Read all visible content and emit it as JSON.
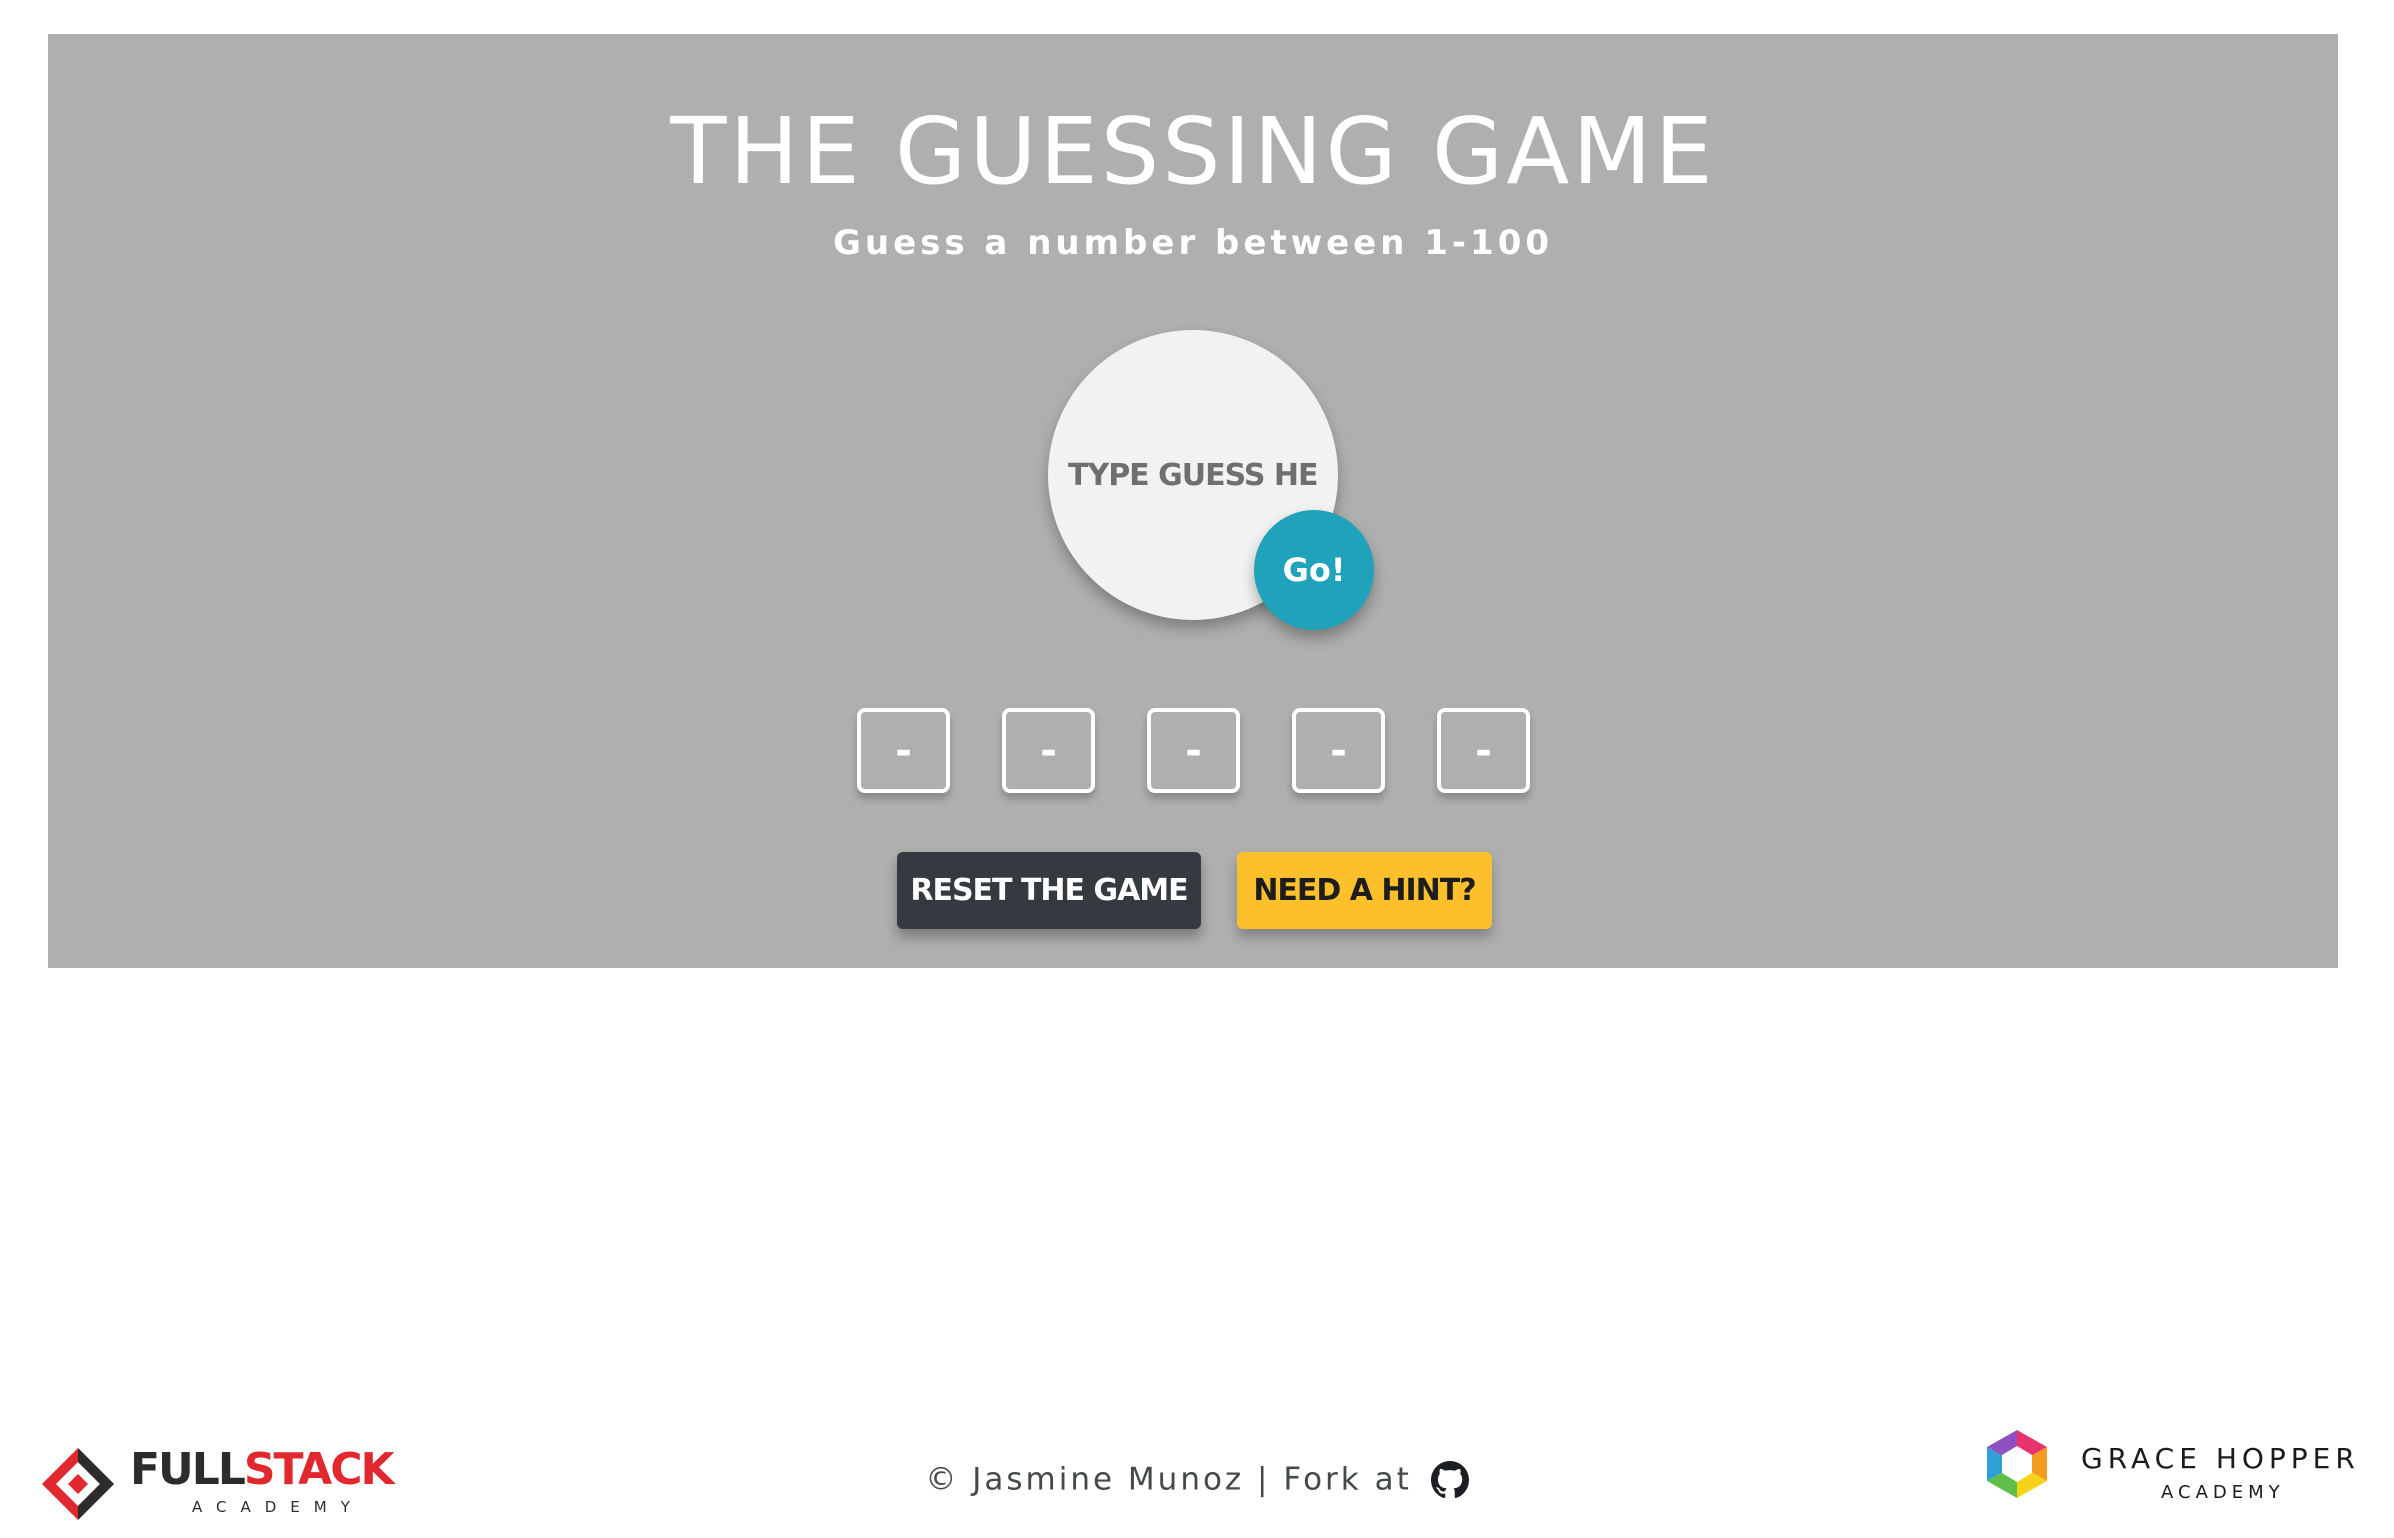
{
  "game": {
    "title": "THE GUESSING GAME",
    "subtitle": "Guess a number between 1-100",
    "input_placeholder": "TYPE GUESS HERE",
    "input_value": "",
    "go_label": "Go!",
    "guesses": [
      "-",
      "-",
      "-",
      "-",
      "-"
    ],
    "reset_label": "RESET THE GAME",
    "hint_label": "NEED A HINT?"
  },
  "footer": {
    "credit": "© Jasmine Munoz | Fork at",
    "github_icon": "github-icon",
    "left_logo": {
      "word_full": "FULL",
      "word_stack": "STACK",
      "sub": "ACADEMY"
    },
    "right_logo": {
      "title": "GRACE HOPPER",
      "sub": "ACADEMY"
    }
  },
  "colors": {
    "panel_bg": "#afafaf",
    "go_button": "#21a2bb",
    "reset_button": "#343a40",
    "hint_button": "#fcc02d",
    "fullstack_red": "#e0282e"
  }
}
